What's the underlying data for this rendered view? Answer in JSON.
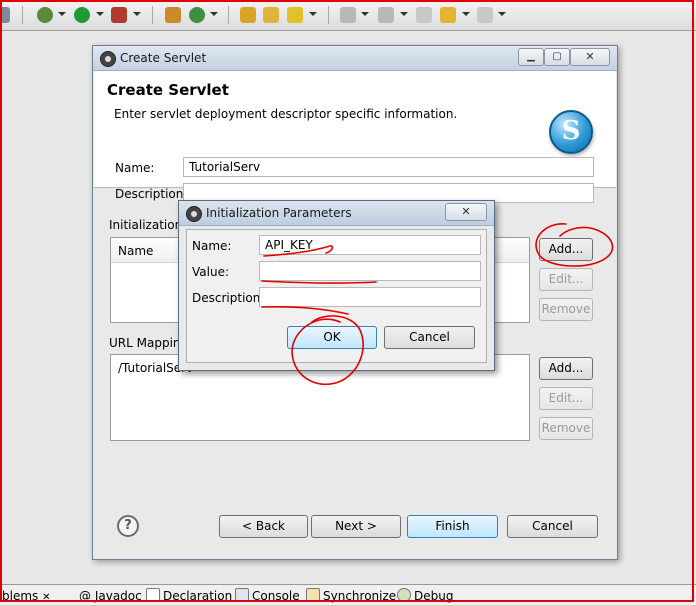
{
  "dialog": {
    "window_title": "Create Servlet",
    "header": "Create Servlet",
    "description": "Enter servlet deployment descriptor specific information.",
    "name_label": "Name:",
    "name_value": "TutorialServ",
    "description_label": "Description:",
    "description_value": "",
    "init_section_label": "Initialization",
    "init_column_name": "Name",
    "init_buttons": {
      "add": "Add...",
      "edit": "Edit...",
      "remove": "Remove"
    },
    "url_section_label": "URL Mapping",
    "url_items": [
      "/TutorialServ"
    ],
    "url_buttons": {
      "add": "Add...",
      "edit": "Edit...",
      "remove": "Remove"
    },
    "footer": {
      "help": "?",
      "back": "< Back",
      "next": "Next >",
      "finish": "Finish",
      "cancel": "Cancel"
    }
  },
  "popup": {
    "title": "Initialization Parameters",
    "name_label": "Name:",
    "name_value": "API_KEY",
    "value_label": "Value:",
    "value_value": "",
    "description_label": "Description:",
    "description_value": "",
    "ok": "OK",
    "cancel": "Cancel"
  },
  "bottom_tabs": [
    "blems",
    "Javadoc",
    "Declaration",
    "Console",
    "Synchronize",
    "Debug"
  ],
  "icons": [
    "debug-icon",
    "run-icon",
    "external-tools-icon",
    "new-package-icon",
    "refresh-icon",
    "open-type-icon",
    "open-folder-icon",
    "wand-icon",
    "nav-down-icon",
    "nav-up-icon",
    "back-icon",
    "forward-icon",
    "s-logo-icon",
    "help-icon"
  ],
  "colors": {
    "annotation": "#e00000",
    "default_button": "#bee6fd"
  }
}
